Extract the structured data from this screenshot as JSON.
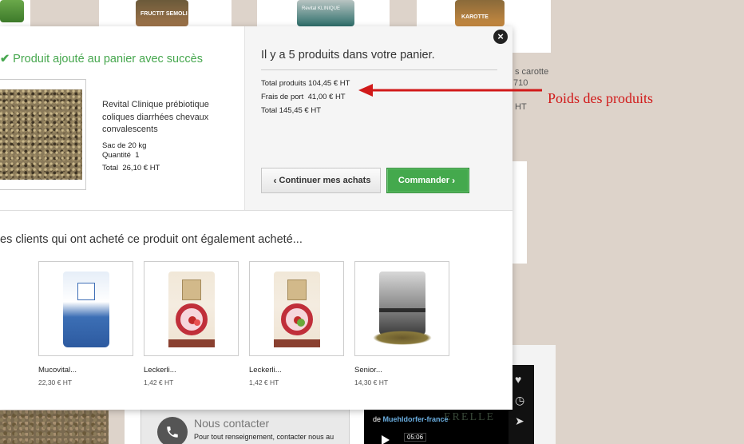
{
  "background": {
    "top_products": [
      {
        "label": "FRUCTIT SEMOLI"
      },
      {
        "label": "Revital KLINIQUE"
      },
      {
        "label": "KAROTTE"
      }
    ],
    "side_text_1": "s carotte",
    "side_text_2": "710",
    "side_text_3": "HT",
    "contact": {
      "title": "Nous contacter",
      "text": "Pour tout renseignement, contacter nous au"
    },
    "video": {
      "by": "de",
      "channel": "Muehldorfer-france",
      "time": "05:06"
    }
  },
  "modal": {
    "close_icon": "close-icon",
    "success_message": "Produit ajouté au panier avec succès",
    "product": {
      "name": "Revital Clinique prébiotique coliques diarrhées chevaux convalescents",
      "size": "Sac de 20 kg",
      "quantity_label": "Quantité",
      "quantity_value": "1",
      "total_label": "Total",
      "total_value": "26,10 € HT"
    },
    "cart": {
      "heading": "Il y a 5 produits dans votre panier.",
      "total_products_label": "Total produits",
      "total_products_value": "104,45 € HT",
      "shipping_label": "Frais de port",
      "shipping_value": "41,00 € HT",
      "total_label": "Total",
      "total_value": "145,45 € HT",
      "continue_label": "Continuer mes achats",
      "order_label": "Commander"
    },
    "cross_sell": {
      "title": "es clients qui ont acheté ce produit ont également acheté...",
      "items": [
        {
          "name": "Mucovital...",
          "price": "22,30 € HT"
        },
        {
          "name": "Leckerli...",
          "price": "1,42 € HT"
        },
        {
          "name": "Leckerli...",
          "price": "1,42 € HT"
        },
        {
          "name": "Senior...",
          "price": "14,30 € HT"
        }
      ]
    }
  },
  "annotation": {
    "text": "Poids des produits",
    "color": "#d11a1a"
  },
  "colors": {
    "success_green": "#46a74e",
    "order_button": "#44a94d",
    "page_background": "#ddd3ca"
  }
}
